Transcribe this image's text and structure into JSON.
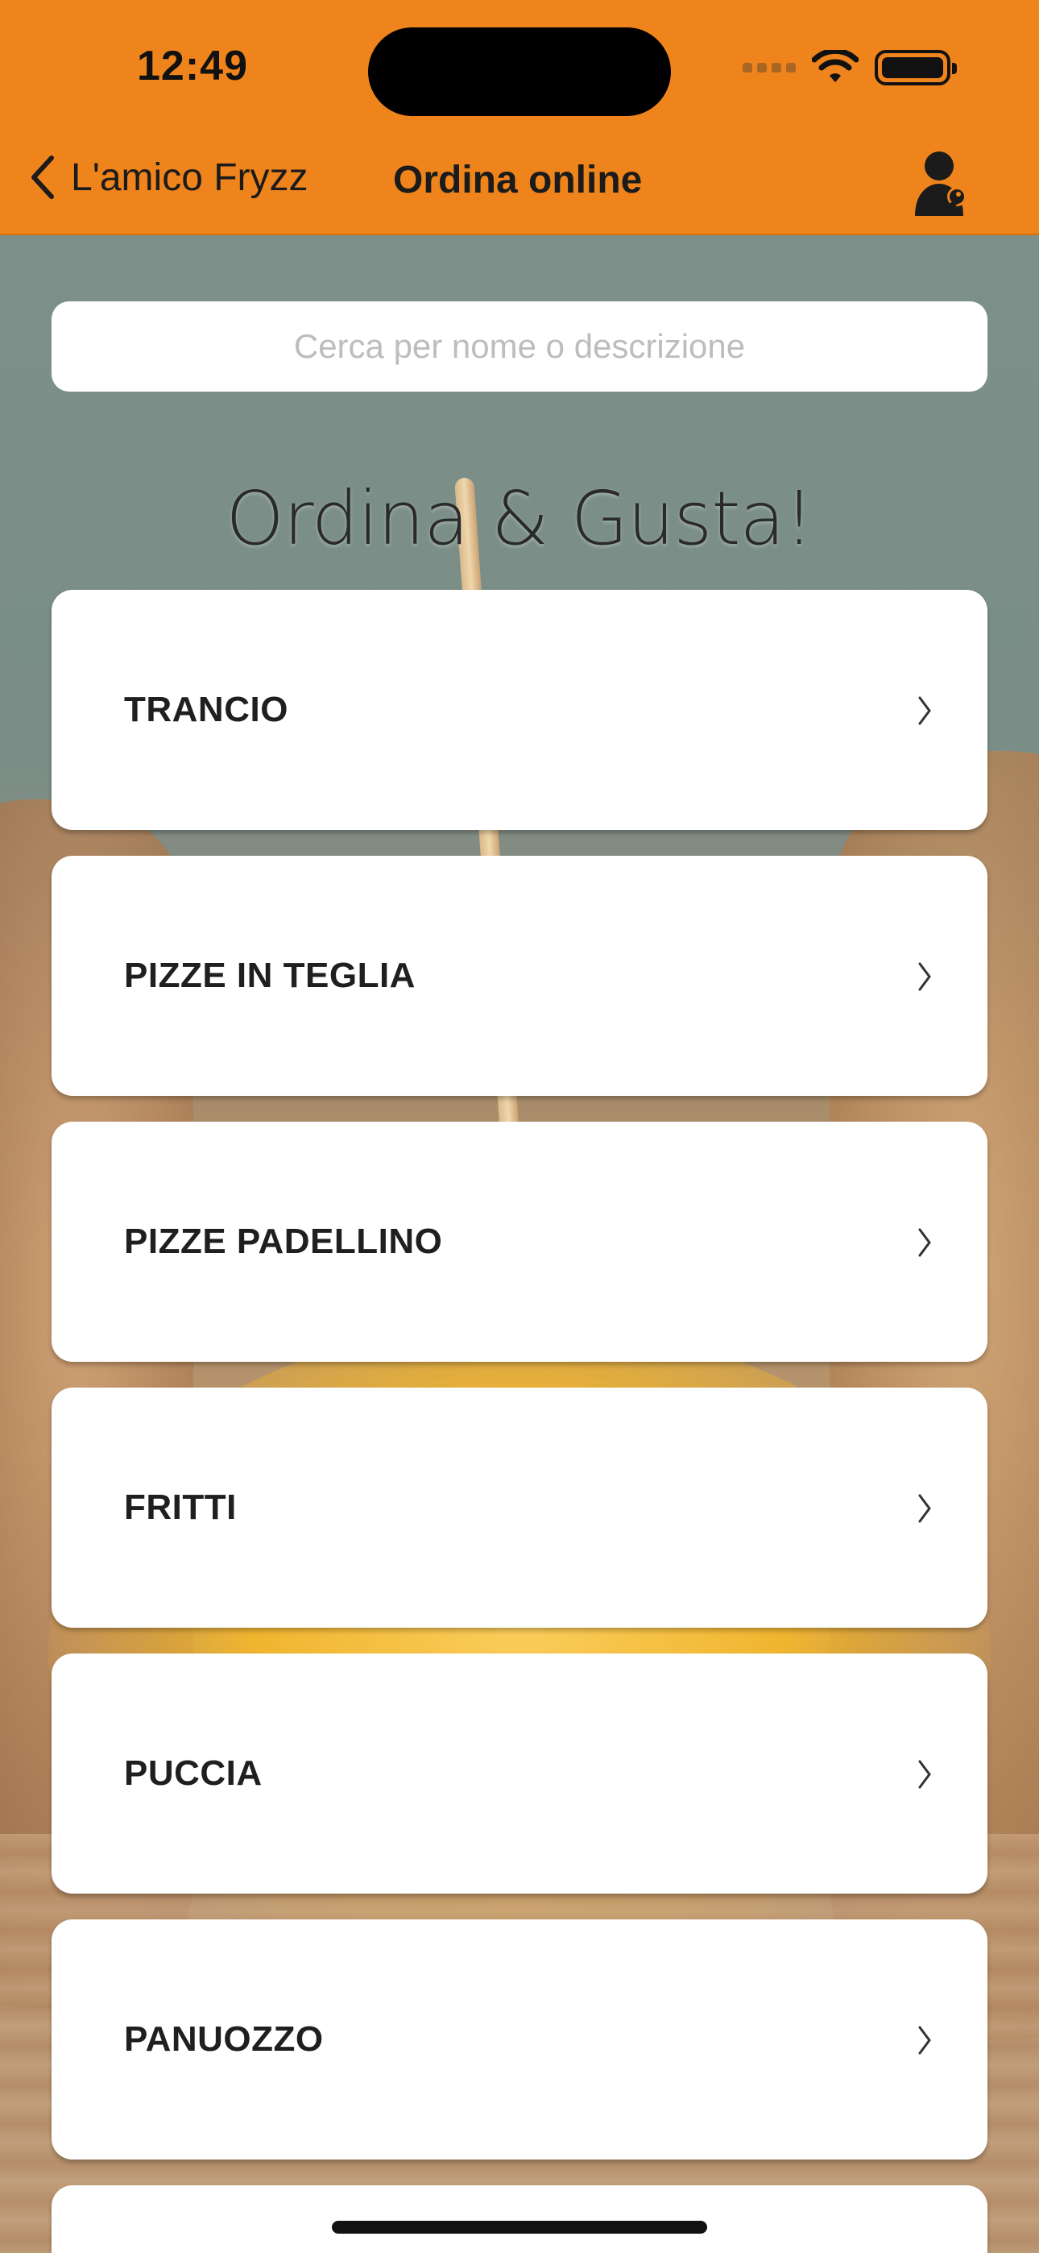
{
  "status_bar": {
    "time": "12:49"
  },
  "nav": {
    "back_label": "L'amico Fryzz",
    "title": "Ordina online",
    "account_icon": "user-key-icon",
    "back_icon": "chevron-left-icon"
  },
  "search": {
    "placeholder": "Cerca per nome o descrizione",
    "value": ""
  },
  "heading": "Ordina & Gusta!",
  "categories": [
    {
      "label": "TRANCIO"
    },
    {
      "label": "PIZZE IN TEGLIA"
    },
    {
      "label": "PIZZE PADELLINO"
    },
    {
      "label": "FRITTI"
    },
    {
      "label": "PUCCIA"
    },
    {
      "label": "PANUOZZO"
    },
    {
      "label": ""
    }
  ],
  "colors": {
    "accent": "#F0841C",
    "card": "#FFFFFF",
    "text": "#1F1F1F"
  }
}
